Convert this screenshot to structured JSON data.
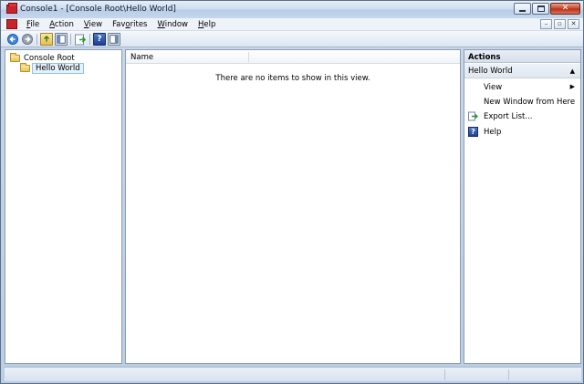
{
  "window": {
    "title": "Console1 - [Console Root\\Hello World]"
  },
  "caption_buttons": {
    "minimize_glyph": "",
    "maximize_glyph": "",
    "close_glyph": "✕"
  },
  "menu": {
    "items": [
      {
        "label_ul": "F",
        "label_rest": "ile"
      },
      {
        "label_ul": "A",
        "label_rest": "ction"
      },
      {
        "label_ul": "V",
        "label_rest": "iew"
      },
      {
        "label_pre": "Fav",
        "label_ul": "o",
        "label_rest": "rites"
      },
      {
        "label_ul": "W",
        "label_rest": "indow"
      },
      {
        "label_ul": "H",
        "label_rest": "elp"
      }
    ],
    "mdi_minimize": "–",
    "mdi_restore": "▫",
    "mdi_close": "✕"
  },
  "toolbar": {
    "icons": [
      "back-arrow-icon",
      "forward-arrow-icon",
      "up-folder-icon",
      "show-hide-tree-icon",
      "export-list-icon",
      "help-icon",
      "show-hide-action-pane-icon"
    ]
  },
  "tree": {
    "root_label": "Console Root",
    "child_label": "Hello World"
  },
  "list": {
    "column_name": "Name",
    "empty_message": "There are no items to show in this view."
  },
  "actions": {
    "title": "Actions",
    "group_label": "Hello World",
    "group_toggle_glyph": "▲",
    "items": [
      {
        "label": "View",
        "submenu_glyph": "▶"
      },
      {
        "label": "New Window from Here"
      },
      {
        "label": "Export List..."
      },
      {
        "label": "Help"
      }
    ]
  },
  "colors": {
    "accent": "#1e5fb0",
    "selection_bg": "#e5f1fb"
  }
}
